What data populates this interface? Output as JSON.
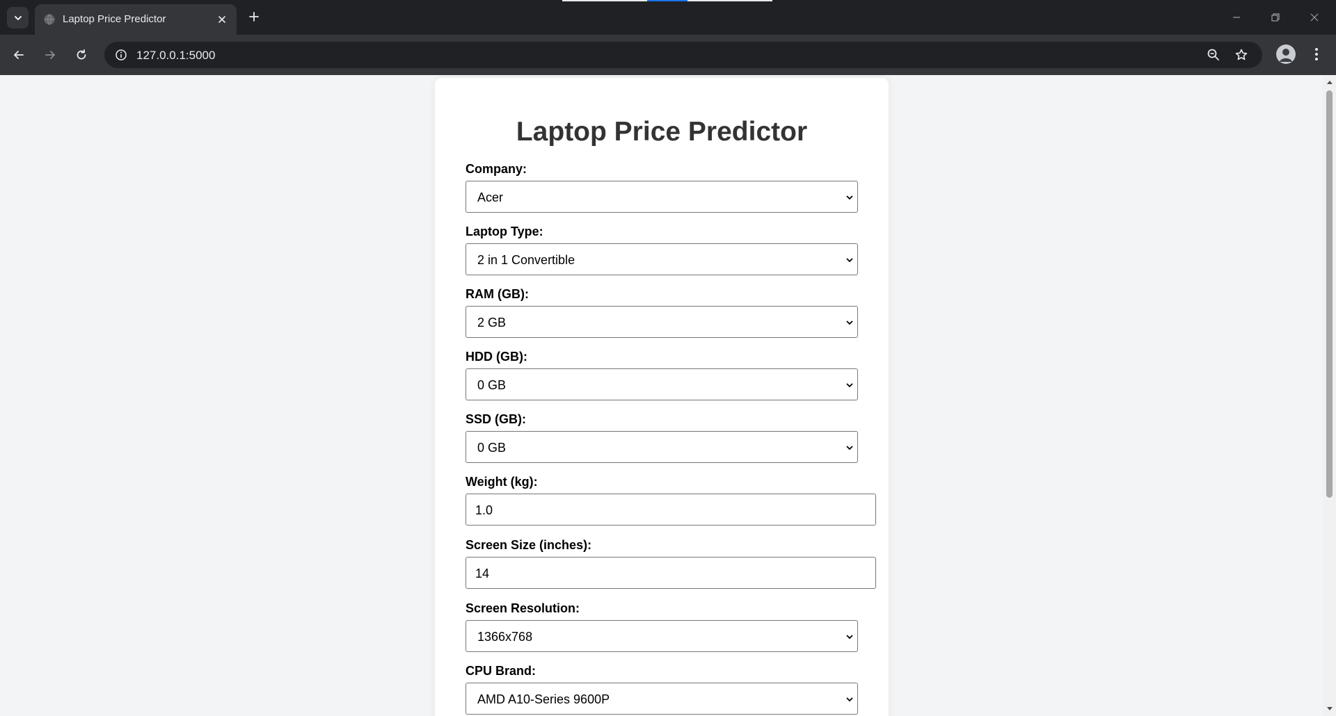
{
  "browser": {
    "tab_title": "Laptop Price Predictor",
    "url": "127.0.0.1:5000",
    "loading_progress": 0.2
  },
  "form": {
    "title": "Laptop Price Predictor",
    "company": {
      "label": "Company:",
      "value": "Acer"
    },
    "laptop_type": {
      "label": "Laptop Type:",
      "value": "2 in 1 Convertible"
    },
    "ram": {
      "label": "RAM (GB):",
      "value": "2 GB"
    },
    "hdd": {
      "label": "HDD (GB):",
      "value": "0 GB"
    },
    "ssd": {
      "label": "SSD (GB):",
      "value": "0 GB"
    },
    "weight": {
      "label": "Weight (kg):",
      "value": "1.0"
    },
    "screen_size": {
      "label": "Screen Size (inches):",
      "value": "14"
    },
    "screen_resolution": {
      "label": "Screen Resolution:",
      "value": "1366x768"
    },
    "cpu_brand": {
      "label": "CPU Brand:",
      "value": "AMD A10-Series 9600P"
    }
  },
  "colors": {
    "chrome_dark": "#202124",
    "chrome_toolbar": "#35363a",
    "page_background": "#f3f4f6",
    "card_background": "#ffffff",
    "title_text": "#333333",
    "progress_accent": "#1a73e8"
  }
}
